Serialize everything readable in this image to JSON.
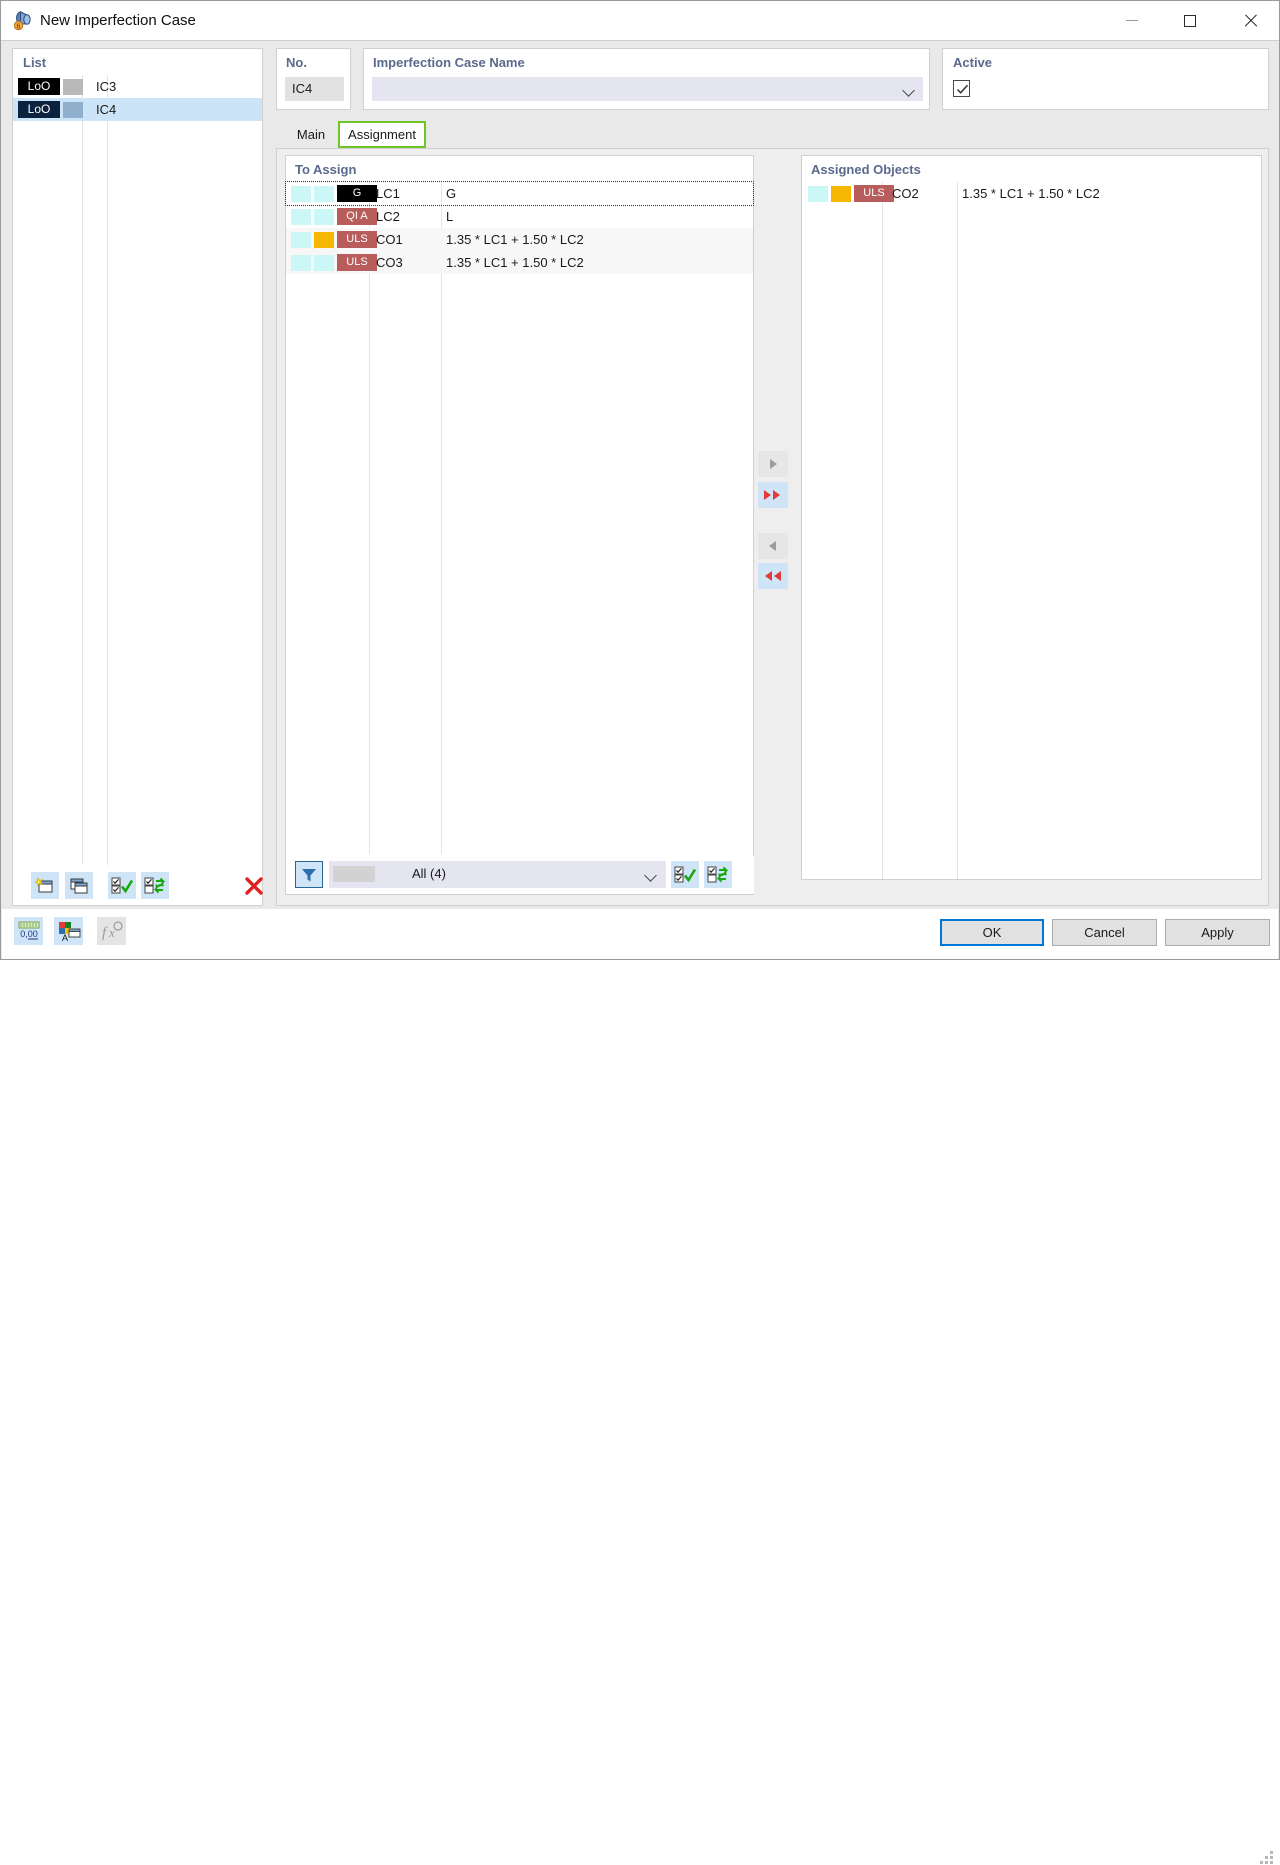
{
  "window": {
    "title": "New Imperfection Case",
    "icon": "imperfection-case-icon",
    "minimize_label": "Minimize",
    "maximize_label": "Maximize",
    "close_label": "Close"
  },
  "list_panel": {
    "title": "List",
    "columns": [
      "type",
      "color",
      "name"
    ],
    "rows": [
      {
        "type": "LoO",
        "color": "#b9b9b9",
        "name": "IC3",
        "selected": false
      },
      {
        "type": "LoO",
        "color": "#8fafcc",
        "name": "IC4",
        "selected": true
      }
    ],
    "toolbar": [
      {
        "name": "new-case-button",
        "icon": "new-window-icon"
      },
      {
        "name": "copy-case-button",
        "icon": "copy-window-icon"
      },
      {
        "name": "select-all-button",
        "icon": "check-all-icon"
      },
      {
        "name": "invert-selection-button",
        "icon": "invert-selection-icon"
      },
      {
        "name": "delete-case-button",
        "icon": "red-x-icon"
      }
    ]
  },
  "no_panel": {
    "title": "No.",
    "value": "IC4"
  },
  "name_panel": {
    "title": "Imperfection Case Name",
    "value": "",
    "placeholder": ""
  },
  "active_panel": {
    "title": "Active",
    "checked": true
  },
  "tabs": [
    {
      "label": "Main",
      "active": false
    },
    {
      "label": "Assignment",
      "active": true
    }
  ],
  "to_assign": {
    "title": "To Assign",
    "rows": [
      {
        "sw1": "#ccf7f7",
        "sw2": "#ccf7f7",
        "badge": "G",
        "badge_style": "black",
        "no": "LC1",
        "desc": "G",
        "focused": true
      },
      {
        "sw1": "#ccf7f7",
        "sw2": "#ccf7f7",
        "badge": "QI A",
        "badge_style": "red",
        "no": "LC2",
        "desc": "L",
        "focused": false
      },
      {
        "sw1": "#ccf7f7",
        "sw2": "#f5b700",
        "badge": "ULS",
        "badge_style": "red",
        "no": "CO1",
        "desc": "1.35 * LC1 + 1.50 * LC2",
        "focused": false
      },
      {
        "sw1": "#ccf7f7",
        "sw2": "#ccf7f7",
        "badge": "ULS",
        "badge_style": "red",
        "no": "CO3",
        "desc": "1.35 * LC1 + 1.50 * LC2",
        "focused": false
      }
    ],
    "filter": {
      "funnel_label": "filter-icon",
      "swatch_color": "#d2d2d2",
      "value": "All (4)",
      "buttons": [
        {
          "name": "filter-check-all-button",
          "icon": "check-all-icon"
        },
        {
          "name": "filter-invert-button",
          "icon": "invert-selection-icon"
        }
      ]
    }
  },
  "transfer_buttons": [
    {
      "name": "assign-one-button",
      "icon": "play-right-icon",
      "state": "disabled"
    },
    {
      "name": "assign-all-button",
      "icon": "double-right-icon",
      "state": "enabled"
    },
    {
      "name": "unassign-one-button",
      "icon": "play-left-icon",
      "state": "disabled"
    },
    {
      "name": "unassign-all-button",
      "icon": "double-left-icon",
      "state": "enabled"
    }
  ],
  "assigned_objects": {
    "title": "Assigned Objects",
    "rows": [
      {
        "sw1": "#ccf7f7",
        "sw2": "#f5b700",
        "badge": "ULS",
        "badge_style": "red",
        "no": "CO2",
        "desc": "1.35 * LC1 + 1.50 * LC2"
      }
    ]
  },
  "bottom_toolbar": [
    {
      "name": "decimal-places-button",
      "icon": "number-format-icon",
      "label": "0,00",
      "enabled": true
    },
    {
      "name": "display-properties-button",
      "icon": "colors-fonts-icon",
      "enabled": true
    },
    {
      "name": "formula-button",
      "icon": "fx-icon",
      "label": "fx",
      "enabled": false
    }
  ],
  "dialog_buttons": [
    {
      "name": "ok-button",
      "label": "OK",
      "default": true
    },
    {
      "name": "cancel-button",
      "label": "Cancel",
      "default": false
    },
    {
      "name": "apply-button",
      "label": "Apply",
      "default": false
    }
  ],
  "colors": {
    "accent_blue": "#0078d7",
    "tab_highlight_green": "#6ec629",
    "selection_blue": "#cce4f7",
    "badge_red": "#b85c5c",
    "badge_black": "#000000",
    "swatch_cyan": "#ccf7f7",
    "swatch_amber": "#f5b700",
    "delete_red": "#e02020",
    "panel_title": "#5a6a8c"
  }
}
